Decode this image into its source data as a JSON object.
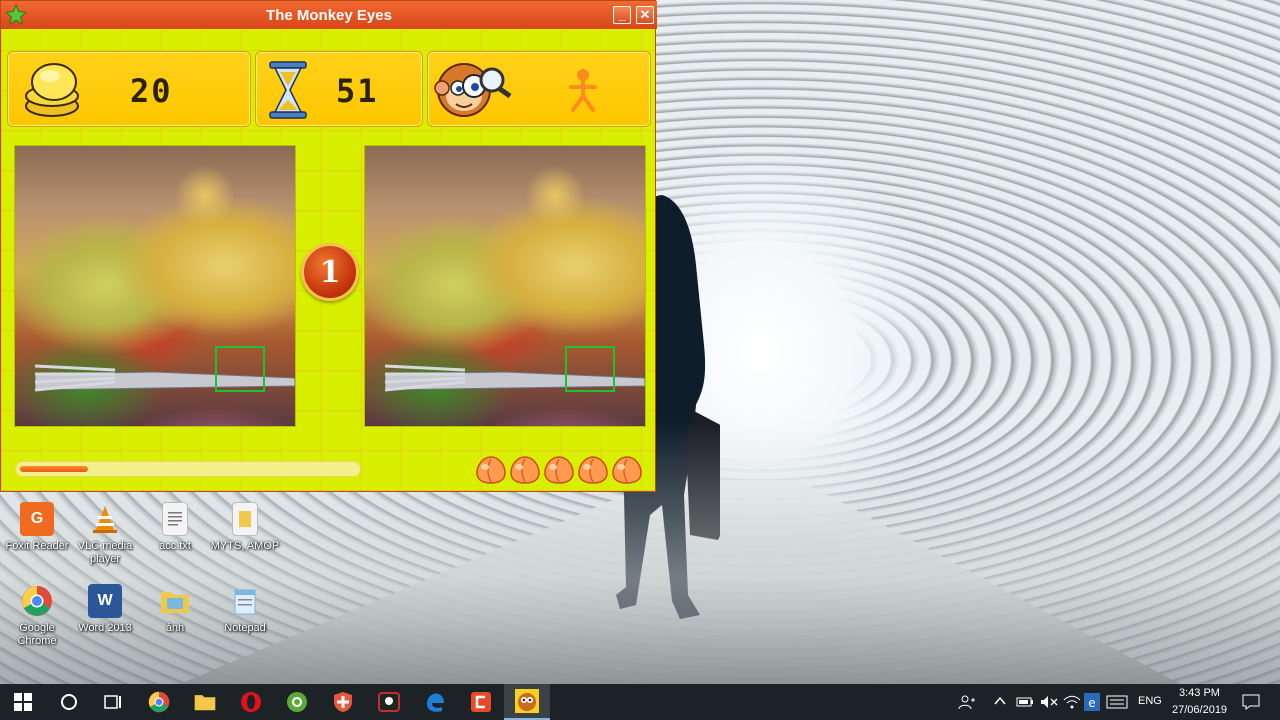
{
  "window": {
    "title": "The Monkey Eyes",
    "minimize_symbol": "_",
    "close_symbol": "✕"
  },
  "hud": {
    "coins": "20",
    "time_left": "51",
    "coins_icon": "coin-stack-icon",
    "timer_icon": "hourglass-icon",
    "monkey_icon": "monkey-magnifier-icon",
    "player_icon": "player-figure-icon"
  },
  "round": {
    "number": "1"
  },
  "progress": {
    "fraction": 0.2
  },
  "lives": {
    "count": 5,
    "icon": "peach-icon"
  },
  "desktop_icons": [
    {
      "label": "Foxit Reader",
      "icon": "foxit-reader-icon",
      "color": "#f06a20"
    },
    {
      "label": "VLC media player",
      "icon": "vlc-cone-icon",
      "color": "#f08a00"
    },
    {
      "label": "acc.txt",
      "icon": "text-file-icon",
      "color": "#f0f0f0"
    },
    {
      "label": "MYTS, AMOP",
      "icon": "document-icon",
      "color": "#f0f0f0"
    },
    {
      "label": "Google Chrome",
      "icon": "chrome-icon",
      "color": "#dd4b39"
    },
    {
      "label": "Word 2013",
      "icon": "word-icon",
      "color": "#2b579a"
    },
    {
      "label": "ảnh",
      "icon": "folder-icon",
      "color": "#f2c84b"
    },
    {
      "label": "Notepad",
      "icon": "notepad-icon",
      "color": "#7ab8e0"
    }
  ],
  "taskbar": {
    "apps": [
      {
        "name": "windows-start",
        "icon": "windows-logo-icon"
      },
      {
        "name": "cortana",
        "icon": "search-circle-icon"
      },
      {
        "name": "task-view",
        "icon": "task-view-icon"
      },
      {
        "name": "chrome",
        "icon": "chrome-icon"
      },
      {
        "name": "file-explorer",
        "icon": "folder-icon"
      },
      {
        "name": "opera",
        "icon": "opera-icon"
      },
      {
        "name": "coccoc",
        "icon": "coccoc-icon"
      },
      {
        "name": "avast",
        "icon": "shield-icon"
      },
      {
        "name": "mail",
        "icon": "mail-app-icon"
      },
      {
        "name": "edge",
        "icon": "edge-icon"
      },
      {
        "name": "camtasia",
        "icon": "camtasia-icon"
      },
      {
        "name": "monkey-eyes",
        "icon": "monkey-app-icon"
      }
    ],
    "language": "ENG",
    "time": "3:43 PM",
    "date": "27/06/2019"
  }
}
